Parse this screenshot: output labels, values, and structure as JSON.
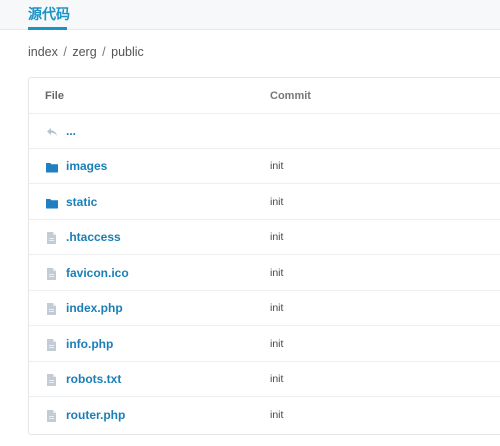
{
  "tab": {
    "label": "源代码"
  },
  "breadcrumb": {
    "parts": [
      "index",
      "zerg",
      "public"
    ]
  },
  "table": {
    "headers": {
      "file": "File",
      "commit": "Commit"
    },
    "parent": {
      "label": "..."
    },
    "rows": [
      {
        "name": "images",
        "type": "folder",
        "commit": "init"
      },
      {
        "name": "static",
        "type": "folder",
        "commit": "init"
      },
      {
        "name": ".htaccess",
        "type": "file",
        "commit": "init"
      },
      {
        "name": "favicon.ico",
        "type": "file",
        "commit": "init"
      },
      {
        "name": "index.php",
        "type": "file",
        "commit": "init"
      },
      {
        "name": "info.php",
        "type": "file",
        "commit": "init"
      },
      {
        "name": "robots.txt",
        "type": "file",
        "commit": "init"
      },
      {
        "name": "router.php",
        "type": "file",
        "commit": "init"
      }
    ]
  },
  "colors": {
    "accent": "#1a93c9",
    "link": "#1a7fb7",
    "folder_icon": "#1f7fc0",
    "file_icon": "#b8c2cc"
  }
}
